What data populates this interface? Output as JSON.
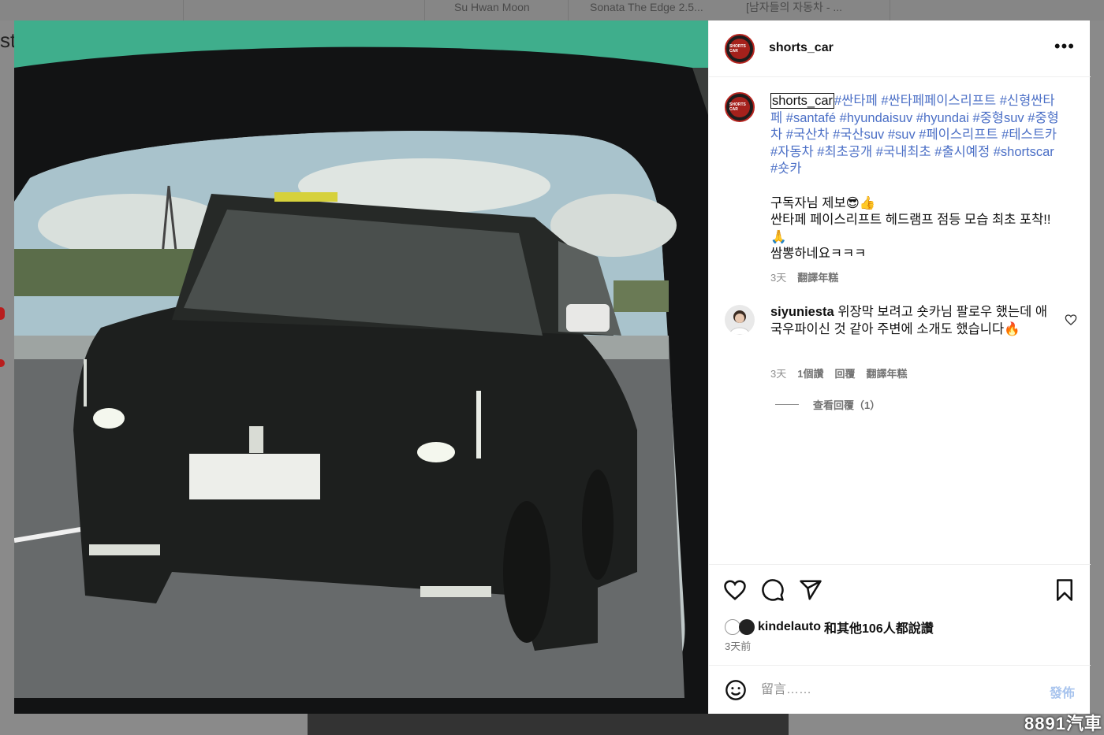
{
  "background": {
    "tabs": [
      "Su Hwan Moon",
      "Sonata The Edge 2.5...",
      "[남자들의 자동차 - ..."
    ],
    "left_char": "st",
    "watermark": "8891汽車"
  },
  "post": {
    "username": "shorts_car",
    "more_icon": "more-horizontal-icon",
    "caption": {
      "username": "shorts_car",
      "hashtags": "#싼타페 #싼타페페이스리프트 #신형싼타페 #santafé #hyundaisuv #hyundai #중형suv #중형차 #국산차 #국산suv #suv #페이스리프트 #테스트카 #자동차 #최초공개 #국내최초 #출시예정 #shortscar #숏카",
      "body": "구독자님 제보😎👍\n싼타페 페이스리프트 헤드램프 점등 모습 최초 포착!!🙏\n쌈뽕하네요ㅋㅋㅋ",
      "time": "3天",
      "translate": "翻譯年糕"
    },
    "comment": {
      "username": "siyuniesta",
      "text": "위장막 보려고 숏카님 팔로우 했는데 애국우파이신 것 같아 주변에 소개도 했습니다🔥",
      "time": "3天",
      "likes": "1個讚",
      "reply": "回覆",
      "translate": "翻譯年糕",
      "view_replies": "查看回覆（1）"
    },
    "likes": {
      "first_user": "kindelauto",
      "text": "和其他106人都說讚"
    },
    "time_ago": "3天前",
    "comment_box": {
      "placeholder": "留言……",
      "post_label": "發佈"
    }
  },
  "icons": {
    "like": "heart-icon",
    "comment": "comment-icon",
    "share": "paper-plane-icon",
    "save": "bookmark-icon",
    "emoji": "smiley-icon"
  }
}
